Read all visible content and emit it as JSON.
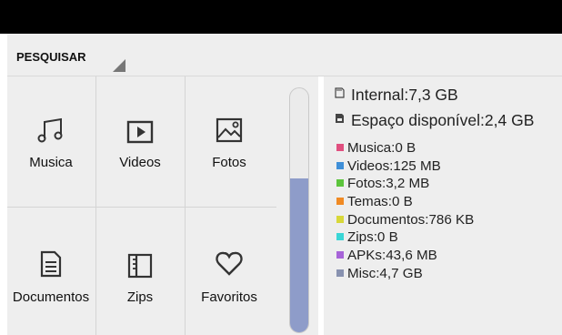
{
  "toolbar": {
    "spinner_label": "PESQUISAR"
  },
  "categories": [
    {
      "label": "Musica",
      "icon": "music-note-icon"
    },
    {
      "label": "Videos",
      "icon": "video-play-icon"
    },
    {
      "label": "Fotos",
      "icon": "image-icon"
    },
    {
      "label": "Documentos",
      "icon": "document-icon"
    },
    {
      "label": "Zips",
      "icon": "zip-book-icon"
    },
    {
      "label": "Favoritos",
      "icon": "heart-icon"
    }
  ],
  "scroll": {
    "fill_fraction": 0.63,
    "color": "#8e9cc9"
  },
  "storage": {
    "internal": "Internal:7,3 GB",
    "available": "Espaço disponível:2,4 GB"
  },
  "legend": [
    {
      "label": "Musica:0 B",
      "color": "#e04f7f"
    },
    {
      "label": "Videos:125 MB",
      "color": "#3f8fd8"
    },
    {
      "label": "Fotos:3,2 MB",
      "color": "#5cc43c"
    },
    {
      "label": "Temas:0 B",
      "color": "#f08a24"
    },
    {
      "label": "Documentos:786 KB",
      "color": "#d8d83a"
    },
    {
      "label": "Zips:0 B",
      "color": "#3ad6d6"
    },
    {
      "label": "APKs:43,6 MB",
      "color": "#a764d8"
    },
    {
      "label": "Misc:4,7 GB",
      "color": "#8892b0"
    }
  ]
}
